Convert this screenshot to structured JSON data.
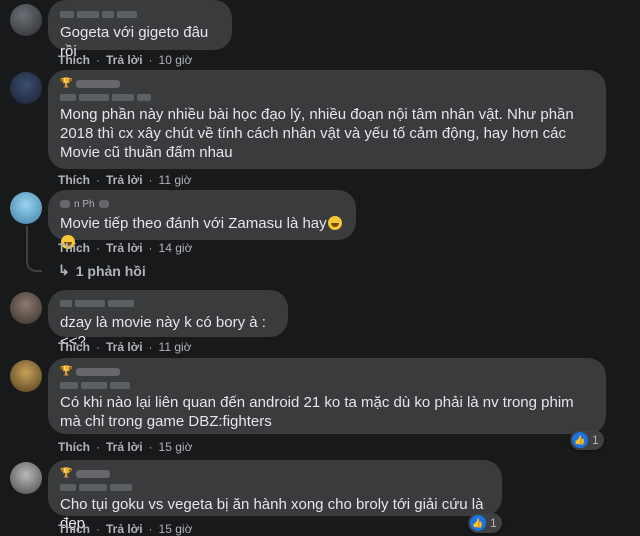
{
  "colors": {
    "background": "#18191a",
    "bubble": "#3a3b3c",
    "text": "#e4e6eb",
    "secondary_text": "#b0b3b8",
    "like_blue": "#1b74e4"
  },
  "action_like": "Thích",
  "action_reply": "Trả lời",
  "comments": [
    {
      "text": "Gogeta với gigeto đâu rồi",
      "time": "10 giờ"
    },
    {
      "text": "Mong phần này nhiều bài học đạo lý, nhiều đoạn nội tâm nhân vật. Như phần 2018 thì cx xây chút về tính cách nhân vật và yếu tố cảm động, hay hơn các Movie cũ thuần đấm nhau",
      "time": "11 giờ"
    },
    {
      "author_visible": "n Ph",
      "text": "Movie tiếp theo đánh với Zamasu là hay",
      "emoji": "rofl-emoji",
      "time": "14 giờ",
      "replies": "1 phản hồi"
    },
    {
      "text": "dzay là movie này k có bory à :<<?",
      "time": "11 giờ"
    },
    {
      "text": "Có khi nào lại liên quan đến android 21 ko ta mặc dù ko phải là nv trong phim mà chỉ trong game DBZ:fighters",
      "time": "15 giờ",
      "reactions": "1"
    },
    {
      "text": "Cho tụi goku vs vegeta bị ăn hành xong cho broly tới giải cứu là đẹp",
      "time": "15 giờ",
      "reactions": "1"
    }
  ]
}
